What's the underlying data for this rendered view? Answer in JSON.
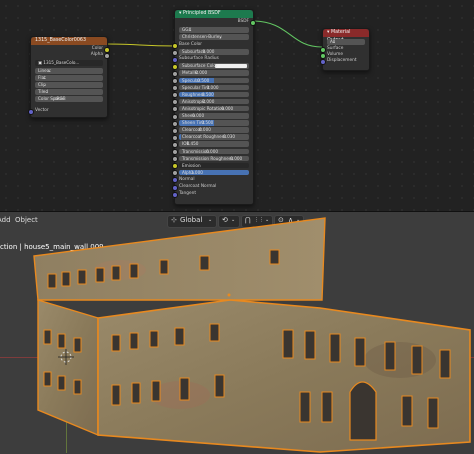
{
  "node_editor": {
    "image_node": {
      "title": "1315_BaseColor0063",
      "outputs": [
        "Color",
        "Alpha"
      ],
      "image_name": "1315_BaseColo...",
      "interpolation": "Linear",
      "projection": "Flat",
      "extension": "Clip",
      "source": "Tiled",
      "color_space_label": "Color Space",
      "color_space_value": "sRGB",
      "vector_label": "Vector",
      "header_color": "#8a4a21"
    },
    "bsdf_node": {
      "title": "Principled BSDF",
      "output": "BSDF",
      "distribution": "GGX",
      "subsurface_method": "Christensen-Burley",
      "header_color": "#1d7a4e",
      "params": [
        {
          "label": "Base Color",
          "type": "socket"
        },
        {
          "label": "Subsurface",
          "value": "0.000",
          "fill": 0.0
        },
        {
          "label": "Subsurface Radius",
          "type": "socket"
        },
        {
          "label": "Subsurface Color",
          "type": "color"
        },
        {
          "label": "Metallic",
          "value": "0.000",
          "fill": 0.0
        },
        {
          "label": "Specular",
          "value": "0.500",
          "fill": 0.5
        },
        {
          "label": "Specular Tint",
          "value": "0.000",
          "fill": 0.0
        },
        {
          "label": "Roughness",
          "value": "0.500",
          "fill": 0.5
        },
        {
          "label": "Anisotropic",
          "value": "0.000",
          "fill": 0.0
        },
        {
          "label": "Anisotropic Rotation",
          "value": "0.000",
          "fill": 0.0
        },
        {
          "label": "Sheen",
          "value": "0.000",
          "fill": 0.0
        },
        {
          "label": "Sheen Tint",
          "value": "0.500",
          "fill": 0.5
        },
        {
          "label": "Clearcoat",
          "value": "0.000",
          "fill": 0.0
        },
        {
          "label": "Clearcoat Roughness",
          "value": "0.030",
          "fill": 0.03
        },
        {
          "label": "IOR",
          "value": "1.450",
          "fill": 0.0
        },
        {
          "label": "Transmission",
          "value": "0.000",
          "fill": 0.0
        },
        {
          "label": "Transmission Roughness",
          "value": "0.000",
          "fill": 0.0
        },
        {
          "label": "Emission",
          "type": "dark"
        },
        {
          "label": "Alpha",
          "value": "1.000",
          "fill": 1.0
        },
        {
          "label": "Normal",
          "type": "socket"
        },
        {
          "label": "Clearcoat Normal",
          "type": "socket"
        },
        {
          "label": "Tangent",
          "type": "socket"
        }
      ]
    },
    "output_node": {
      "title": "Material Output",
      "target": "All",
      "inputs": [
        "Surface",
        "Volume",
        "Displacement"
      ],
      "header_color": "#8a2a2a"
    }
  },
  "viewport": {
    "header": {
      "add_menu": "Add",
      "object_menu": "Object",
      "transform_orientation": "Global"
    },
    "breadcrumb": "ction | house5_main_wall.009",
    "selection_outline_color": "#e8891f"
  }
}
